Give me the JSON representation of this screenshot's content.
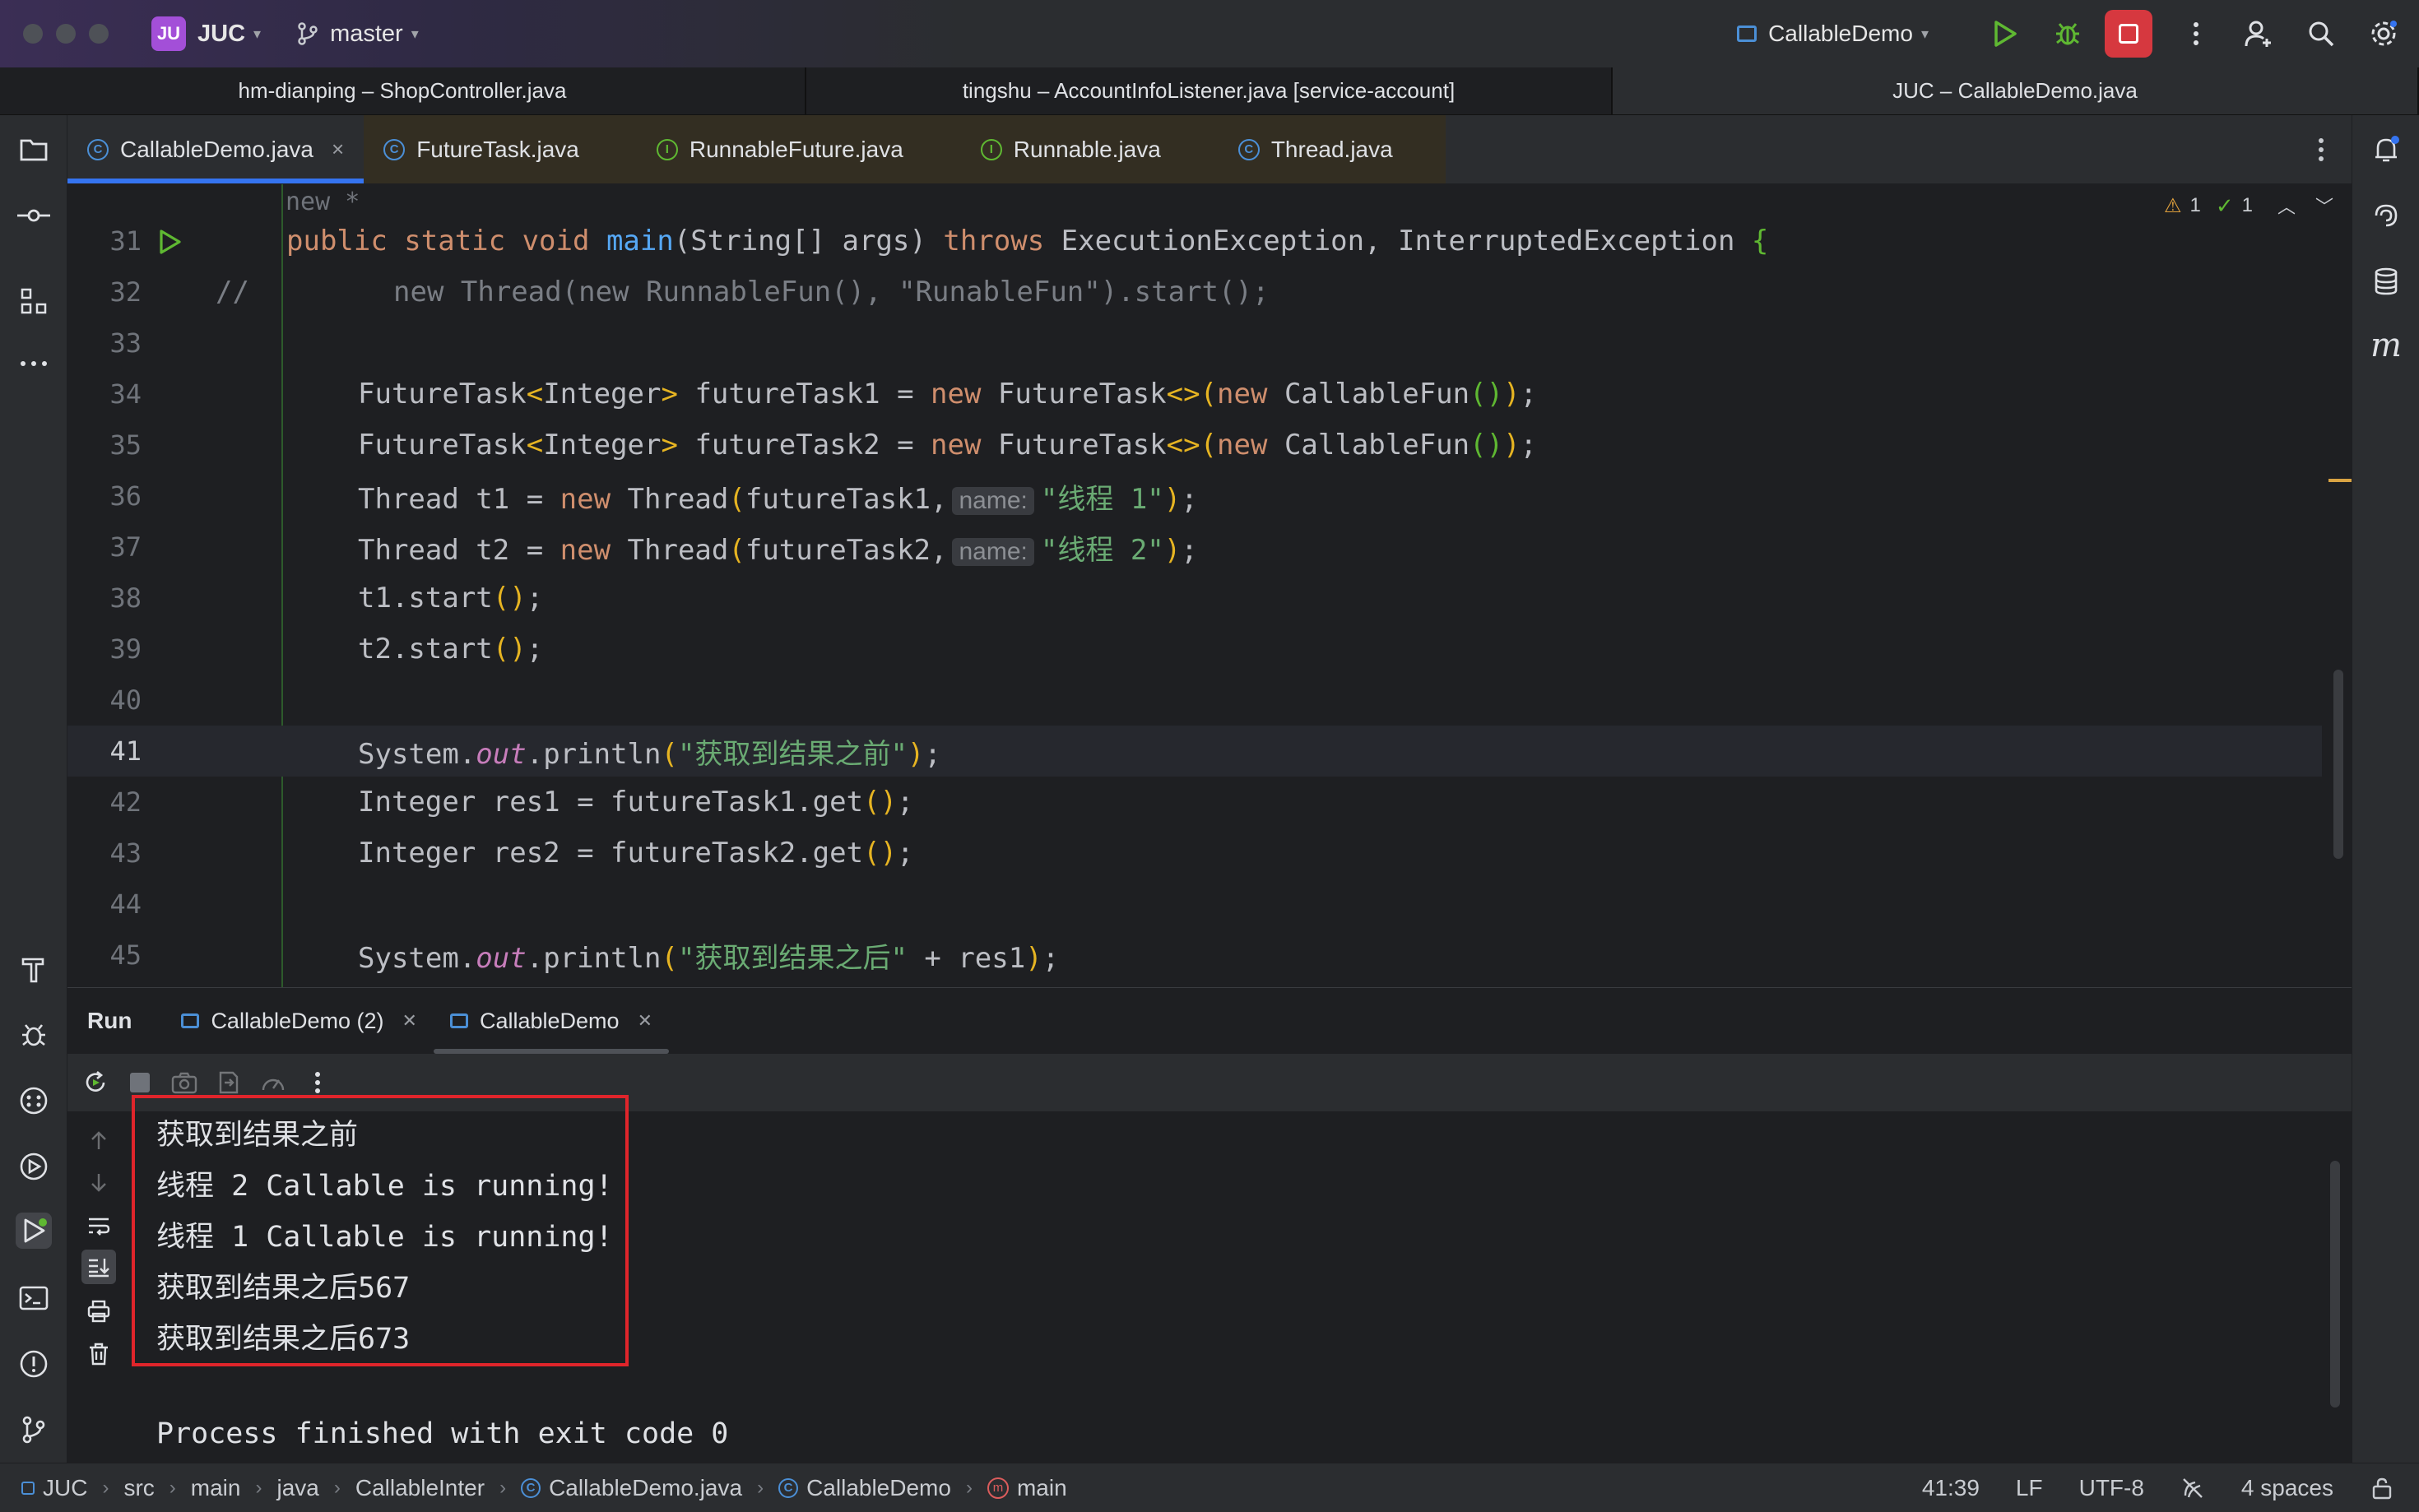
{
  "titlebar": {
    "project_badge": "JU",
    "project_name": "JUC",
    "branch": "master",
    "run_config": "CallableDemo"
  },
  "window_tabs": [
    {
      "label": "hm-dianping – ShopController.java"
    },
    {
      "label": "tingshu – AccountInfoListener.java [service-account]"
    },
    {
      "label": "JUC – CallableDemo.java"
    }
  ],
  "editor_tabs": [
    {
      "label": "CallableDemo.java",
      "kind": "C"
    },
    {
      "label": "FutureTask.java",
      "kind": "C"
    },
    {
      "label": "RunnableFuture.java",
      "kind": "I"
    },
    {
      "label": "Runnable.java",
      "kind": "I"
    },
    {
      "label": "Thread.java",
      "kind": "C"
    }
  ],
  "editor": {
    "inlay_usage": "new *",
    "warnings_count": "1",
    "checks_count": "1",
    "line_numbers": [
      "31",
      "32",
      "33",
      "34",
      "35",
      "36",
      "37",
      "38",
      "39",
      "40",
      "41",
      "42",
      "43",
      "44",
      "45"
    ],
    "current_line": "41",
    "hint_name": "name:",
    "lines": {
      "l31": {
        "a": "public static void ",
        "b": "main",
        "c": "(String[] args) ",
        "d": "throws",
        "e": " ExecutionException, InterruptedException ",
        "f": "{"
      },
      "l32": {
        "a": "//",
        "b": "new Thread(new RunnableFun(), \"RunableFun\").start();"
      },
      "l34": {
        "a": "FutureTask",
        "b": "<",
        "c": "Integer",
        "d": ">",
        "e": " futureTask1 = ",
        "f": "new",
        "g": " FutureTask",
        "h": "<>",
        "i": "(",
        "j": "new",
        "k": " CallableFun",
        "l": "()",
        "m": ")",
        "n": ";"
      },
      "l35": {
        "a": "FutureTask",
        "b": "<",
        "c": "Integer",
        "d": ">",
        "e": " futureTask2 = ",
        "f": "new",
        "g": " FutureTask",
        "h": "<>",
        "i": "(",
        "j": "new",
        "k": " CallableFun",
        "l": "()",
        "m": ")",
        "n": ";"
      },
      "l36": {
        "a": "Thread t1 = ",
        "b": "new",
        "c": " Thread",
        "d": "(",
        "e": "futureTask1,",
        "f": "\"线程 1\"",
        "g": ")",
        "h": ";"
      },
      "l37": {
        "a": "Thread t2 = ",
        "b": "new",
        "c": " Thread",
        "d": "(",
        "e": "futureTask2,",
        "f": "\"线程 2\"",
        "g": ")",
        "h": ";"
      },
      "l38": {
        "a": "t1.start",
        "b": "()",
        "c": ";"
      },
      "l39": {
        "a": "t2.start",
        "b": "()",
        "c": ";"
      },
      "l41": {
        "a": "System.",
        "b": "out",
        "c": ".println",
        "d": "(",
        "e": "\"获取到结果之前\"",
        "f": ")",
        "g": ";"
      },
      "l42": {
        "a": "Integer res1 = futureTask1.get",
        "b": "()",
        "c": ";"
      },
      "l43": {
        "a": "Integer res2 = futureTask2.get",
        "b": "()",
        "c": ";"
      },
      "l45": {
        "a": "System.",
        "b": "out",
        "c": ".println",
        "d": "(",
        "e": "\"获取到结果之后\"",
        "f": " + res1",
        "g": ")",
        "h": ";"
      }
    }
  },
  "run_panel": {
    "title": "Run",
    "tabs": [
      {
        "label": "CallableDemo (2)"
      },
      {
        "label": "CallableDemo"
      }
    ],
    "output": [
      "获取到结果之前",
      "线程 2 Callable is running!",
      "线程 1 Callable is running!",
      "获取到结果之后567",
      "获取到结果之后673",
      "",
      "Process finished with exit code 0"
    ]
  },
  "statusbar": {
    "crumbs": [
      "JUC",
      "src",
      "main",
      "java",
      "CallableInter",
      "CallableDemo.java",
      "CallableDemo",
      "main"
    ],
    "position": "41:39",
    "line_sep": "LF",
    "encoding": "UTF-8",
    "indent": "4 spaces"
  },
  "colors": {
    "accent": "#3574f0",
    "stop_button": "#d6383f",
    "highlight_box": "#e0252b",
    "run_green": "#5fb832"
  }
}
